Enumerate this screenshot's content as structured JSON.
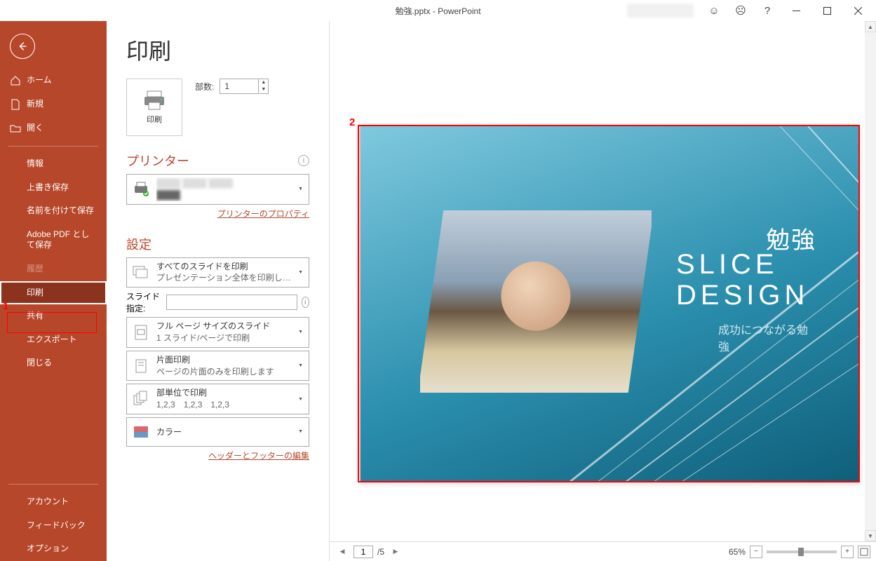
{
  "titlebar": {
    "title": "勉強.pptx  -  PowerPoint"
  },
  "sidebar": {
    "home": "ホーム",
    "new": "新規",
    "open": "開く",
    "info": "情報",
    "save": "上書き保存",
    "saveas": "名前を付けて保存",
    "adobepdf": "Adobe PDF として保存",
    "history": "履歴",
    "print": "印刷",
    "share": "共有",
    "export": "エクスポート",
    "close": "閉じる",
    "account": "アカウント",
    "feedback": "フィードバック",
    "options": "オプション"
  },
  "print": {
    "heading": "印刷",
    "print_btn": "印刷",
    "copies_label": "部数:",
    "copies_value": "1",
    "printer_heading": "プリンター",
    "printer_props": "プリンターのプロパティ",
    "settings_heading": "設定",
    "what": {
      "line1": "すべてのスライドを印刷",
      "line2": "プレゼンテーション全体を印刷し…"
    },
    "slide_spec_label": "スライド指定:",
    "layout": {
      "line1": "フル ページ サイズのスライド",
      "line2": "1 スライド/ページで印刷"
    },
    "sides": {
      "line1": "片面印刷",
      "line2": "ページの片面のみを印刷します"
    },
    "collate": {
      "line1": "部単位で印刷",
      "line2": "1,2,3　1,2,3　1,2,3"
    },
    "color": {
      "line1": "カラー"
    },
    "hf_link": "ヘッダーとフッターの編集"
  },
  "preview": {
    "slide_title1": "勉強",
    "slide_title2": "SLICE DESIGN",
    "slide_sub": "成功につながる勉強"
  },
  "status": {
    "page_current": "1",
    "page_total": "/5",
    "zoom_label": "65%"
  },
  "annotations": {
    "a1": "1",
    "a2": "2"
  }
}
